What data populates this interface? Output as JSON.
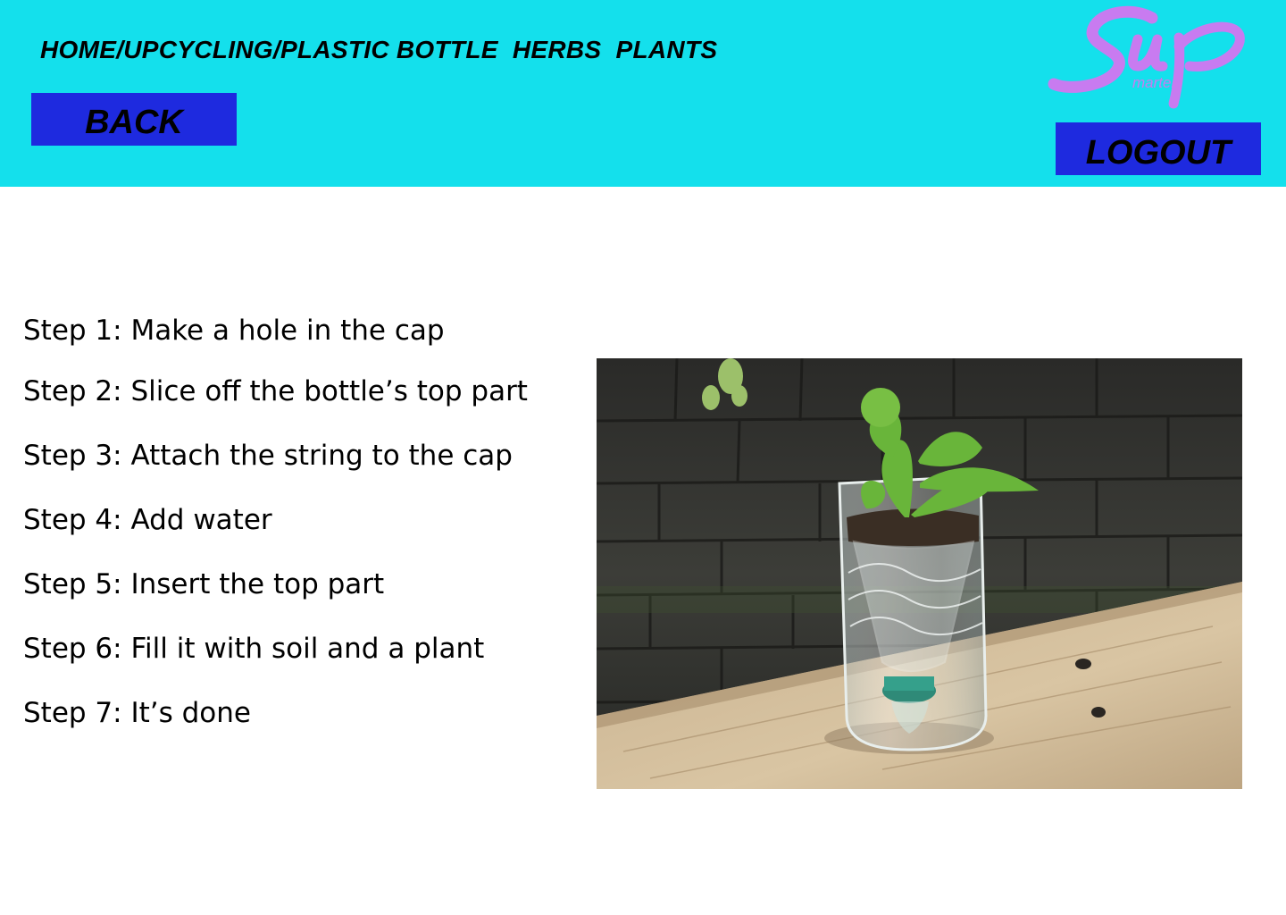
{
  "header": {
    "breadcrumb": "HOME/UPCYCLING/PLASTIC BOTTLE  HERBS  PLANTS",
    "back_label": "BACK",
    "logout_label": "LOGOUT",
    "logo_icon": "smarten-logo",
    "logo_text": "marten",
    "background_color": "#14e0ec",
    "button_color": "#1e2adf",
    "logo_color": "#c87bf0"
  },
  "steps": [
    "Step 1: Make a hole in the cap",
    "Step 2: Slice off the bottle’s top part",
    "Step 3: Attach the string to the cap",
    "Step 4: Add water",
    "Step 5: Insert the top part",
    "Step 6: Fill it with soil and a plant",
    "Step 7: It’s done"
  ],
  "photo": {
    "icon": "plastic-bottle-planter-photo"
  }
}
